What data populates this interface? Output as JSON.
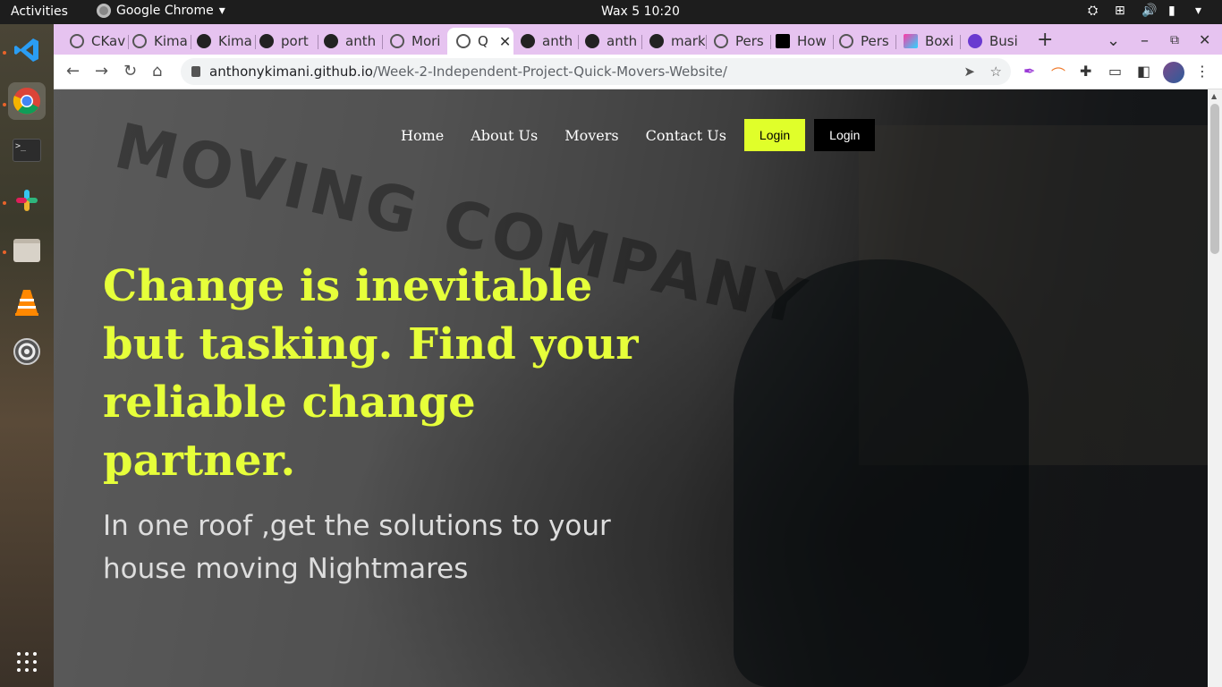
{
  "system": {
    "activities": "Activities",
    "app_name": "Google Chrome",
    "clock": "Wax 5  10:20"
  },
  "dock": {
    "items": [
      "vscode-icon",
      "chrome-icon",
      "terminal-icon",
      "slack-icon",
      "files-icon",
      "vlc-icon",
      "settings-icon",
      "app-grid-icon"
    ]
  },
  "tabs": [
    {
      "label": "CKav",
      "icon": "globe"
    },
    {
      "label": "Kima",
      "icon": "globe"
    },
    {
      "label": "Kima",
      "icon": "github"
    },
    {
      "label": "port",
      "icon": "globe"
    },
    {
      "label": "anth",
      "icon": "github"
    },
    {
      "label": "Mori",
      "icon": "globe"
    },
    {
      "label": "Q",
      "icon": "globe",
      "active": true
    },
    {
      "label": "anth",
      "icon": "github"
    },
    {
      "label": "anth",
      "icon": "github"
    },
    {
      "label": "mark",
      "icon": "github"
    },
    {
      "label": "Pers",
      "icon": "globe"
    },
    {
      "label": "How",
      "icon": "dev"
    },
    {
      "label": "Pers",
      "icon": "globe"
    },
    {
      "label": "Boxi",
      "icon": "box"
    },
    {
      "label": "Busi",
      "icon": "bot"
    }
  ],
  "address": {
    "host": "anthonykimani.github.io",
    "path": "/Week-2-Independent-Project-Quick-Movers-Website/"
  },
  "site": {
    "nav": [
      "Home",
      "About Us",
      "Movers",
      "Contact Us"
    ],
    "login_primary": "Login",
    "login_secondary": "Login",
    "hero_title": "Change is inevitable but tasking. Find your reliable change partner.",
    "hero_subtitle": "In one roof ,get the solutions to your house moving Nightmares",
    "accent_color": "#e0ff2a"
  }
}
